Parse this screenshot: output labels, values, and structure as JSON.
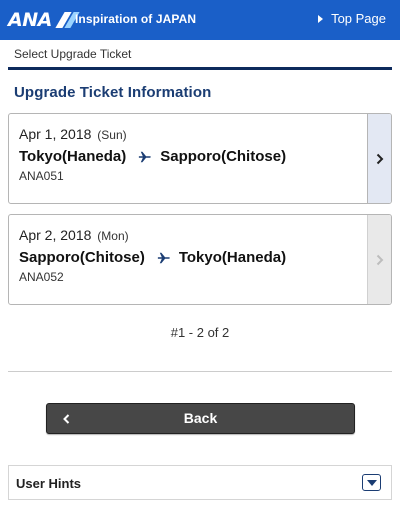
{
  "header": {
    "logo_text": "ANA",
    "tagline": "Inspiration of JAPAN",
    "top_page_link": "Top Page",
    "bg_color": "#1a5fc8"
  },
  "breadcrumb": "Select Upgrade Ticket",
  "section_title": "Upgrade Ticket Information",
  "flights": [
    {
      "date": "Apr 1, 2018",
      "day": "(Sun)",
      "origin": "Tokyo(Haneda)",
      "destination": "Sapporo(Chitose)",
      "flight_no": "ANA051",
      "icon": "airplane-icon",
      "selectable": true
    },
    {
      "date": "Apr 2, 2018",
      "day": "(Mon)",
      "origin": "Sapporo(Chitose)",
      "destination": "Tokyo(Haneda)",
      "flight_no": "ANA052",
      "icon": "airplane-icon",
      "selectable": false
    }
  ],
  "pagination": "#1 - 2 of 2",
  "back_button": "Back",
  "user_hints": {
    "label": "User Hints",
    "icon": "chevron-down-icon"
  },
  "colors": {
    "brand_blue": "#1a5fc8",
    "navy": "#1b3d73",
    "button_dark": "#474747"
  }
}
